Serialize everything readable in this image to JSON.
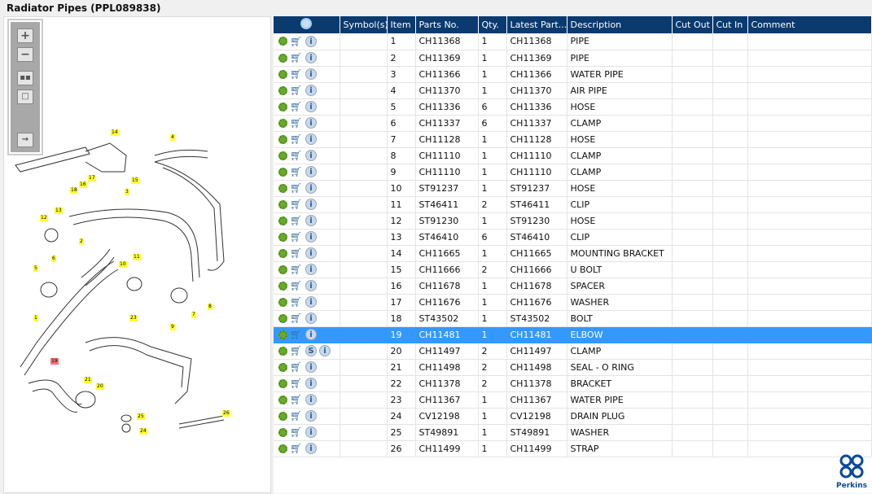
{
  "title": "Radiator Pipes (PPL089838)",
  "columns": [
    "",
    "Symbol(s)",
    "Item",
    "Parts No.",
    "Qty.",
    "Latest Part...",
    "Description",
    "Cut Out",
    "Cut In",
    "Comment"
  ],
  "rows": [
    [
      "1",
      "CH11368",
      "1",
      "CH11368",
      "PIPE"
    ],
    [
      "2",
      "CH11369",
      "1",
      "CH11369",
      "PIPE"
    ],
    [
      "3",
      "CH11366",
      "1",
      "CH11366",
      "WATER PIPE"
    ],
    [
      "4",
      "CH11370",
      "1",
      "CH11370",
      "AIR PIPE"
    ],
    [
      "5",
      "CH11336",
      "6",
      "CH11336",
      "HOSE"
    ],
    [
      "6",
      "CH11337",
      "6",
      "CH11337",
      "CLAMP"
    ],
    [
      "7",
      "CH11128",
      "1",
      "CH11128",
      "HOSE"
    ],
    [
      "8",
      "CH11110",
      "1",
      "CH11110",
      "CLAMP"
    ],
    [
      "9",
      "CH11110",
      "1",
      "CH11110",
      "CLAMP"
    ],
    [
      "10",
      "ST91237",
      "1",
      "ST91237",
      "HOSE"
    ],
    [
      "11",
      "ST46411",
      "2",
      "ST46411",
      "CLIP"
    ],
    [
      "12",
      "ST91230",
      "1",
      "ST91230",
      "HOSE"
    ],
    [
      "13",
      "ST46410",
      "6",
      "ST46410",
      "CLIP"
    ],
    [
      "14",
      "CH11665",
      "1",
      "CH11665",
      "MOUNTING BRACKET"
    ],
    [
      "15",
      "CH11666",
      "2",
      "CH11666",
      "U BOLT"
    ],
    [
      "16",
      "CH11678",
      "1",
      "CH11678",
      "SPACER"
    ],
    [
      "17",
      "CH11676",
      "1",
      "CH11676",
      "WASHER"
    ],
    [
      "18",
      "ST43502",
      "1",
      "ST43502",
      "BOLT"
    ],
    [
      "19",
      "CH11481",
      "1",
      "CH11481",
      "ELBOW"
    ],
    [
      "20",
      "CH11497",
      "2",
      "CH11497",
      "CLAMP"
    ],
    [
      "21",
      "CH11498",
      "2",
      "CH11498",
      "SEAL - O RING"
    ],
    [
      "22",
      "CH11378",
      "2",
      "CH11378",
      "BRACKET"
    ],
    [
      "23",
      "CH11367",
      "1",
      "CH11367",
      "WATER PIPE"
    ],
    [
      "24",
      "CV12198",
      "1",
      "CV12198",
      "DRAIN PLUG"
    ],
    [
      "25",
      "ST49891",
      "1",
      "ST49891",
      "WASHER"
    ],
    [
      "26",
      "CH11499",
      "1",
      "CH11499",
      "STRAP"
    ]
  ],
  "selected_item": "19",
  "symbol_row": "20",
  "symbol_label": "S",
  "info_label": "i",
  "logo": "Perkins",
  "accent": "#0a3a6e",
  "selection": "#3399ff"
}
